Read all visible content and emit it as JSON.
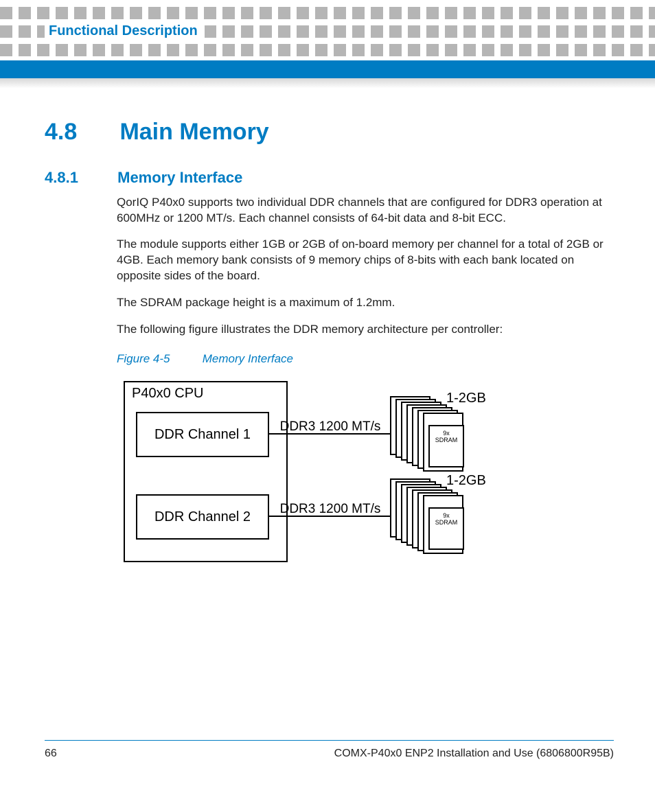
{
  "header": {
    "chapter_title": "Functional Description"
  },
  "section": {
    "number": "4.8",
    "title": "Main Memory"
  },
  "subsection": {
    "number": "4.8.1",
    "title": "Memory Interface"
  },
  "paragraphs": {
    "p1": "QorIQ P40x0 supports two individual DDR channels that are configured for DDR3 operation at 600MHz or 1200 MT/s. Each channel consists of 64-bit data and 8-bit ECC.",
    "p2": "The module supports either 1GB or 2GB of on-board memory per channel for a total of 2GB or 4GB. Each memory bank consists of 9 memory chips of 8-bits with each bank located on opposite sides of the board.",
    "p3": "The SDRAM package height is a maximum of 1.2mm.",
    "p4": "The following figure illustrates the DDR memory architecture per controller:"
  },
  "figure": {
    "caption_number": "Figure 4-5",
    "caption_title": "Memory Interface",
    "cpu_label": "P40x0 CPU",
    "channel1_label": "DDR Channel 1",
    "channel2_label": "DDR Channel 2",
    "link_label": "DDR3 1200 MT/s",
    "capacity_label": "1-2GB",
    "sdram_label_line1": "9x",
    "sdram_label_line2": "SDRAM"
  },
  "footer": {
    "page_number": "66",
    "doc_title": "COMX-P40x0 ENP2 Installation and Use (6806800R95B)"
  }
}
